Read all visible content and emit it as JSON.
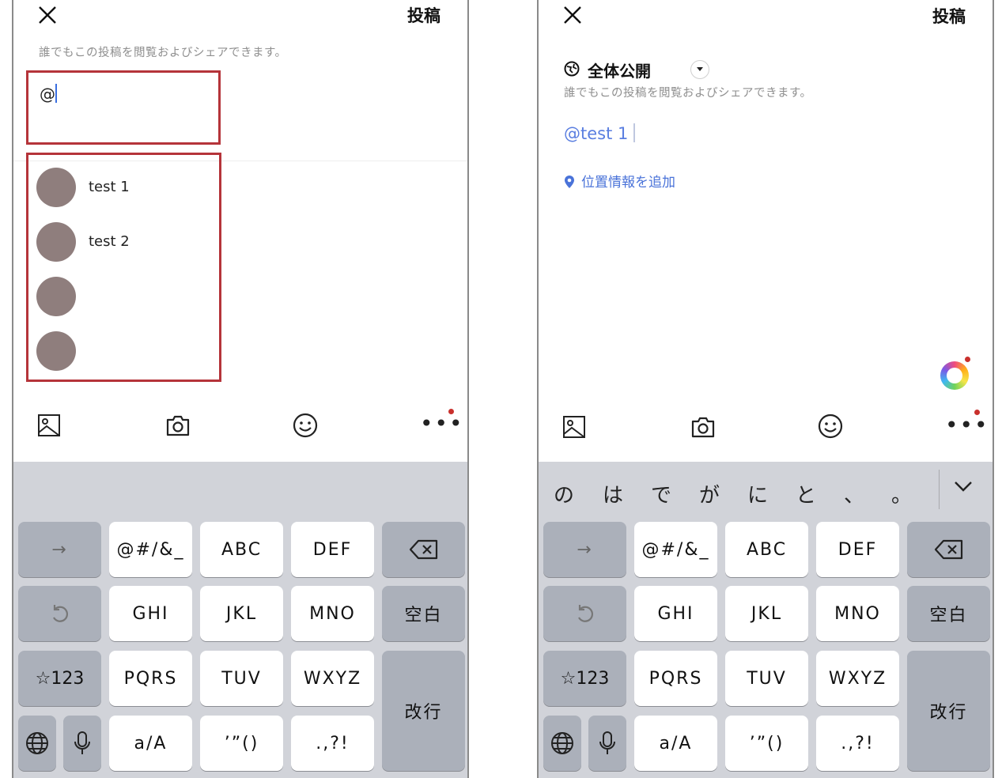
{
  "left": {
    "header": {
      "post_label": "投稿"
    },
    "hint": "誰でもこの投稿を閲覧およびシェアできます。",
    "compose_text": "@",
    "mentions": [
      {
        "name": "test 1"
      },
      {
        "name": "test 2"
      },
      {
        "name": ""
      },
      {
        "name": ""
      }
    ]
  },
  "right": {
    "header": {
      "post_label": "投稿"
    },
    "audience": {
      "label": "全体公開"
    },
    "hint": "誰でもこの投稿を閲覧およびシェアできます。",
    "compose_text": "@test 1",
    "location_label": "位置情報を追加"
  },
  "keyboard": {
    "predictions": [
      "の",
      "は",
      "で",
      "が",
      "に",
      "と",
      "、",
      "。"
    ],
    "row1": [
      "@#/&_",
      "ABC",
      "DEF"
    ],
    "row2": [
      "GHI",
      "JKL",
      "MNO"
    ],
    "row3": [
      "PQRS",
      "TUV",
      "WXYZ"
    ],
    "row4": [
      "a/A",
      "’”()",
      ".,?!"
    ],
    "arrow": "→",
    "space": "空白",
    "symbols": "☆123",
    "return": "改行"
  },
  "colors": {
    "highlight_border": "#b5343a",
    "link": "#4a73d9",
    "avatar": "#8f7e7d",
    "keyboard_bg": "#d1d3d9",
    "dark_key": "#abb0ba"
  }
}
